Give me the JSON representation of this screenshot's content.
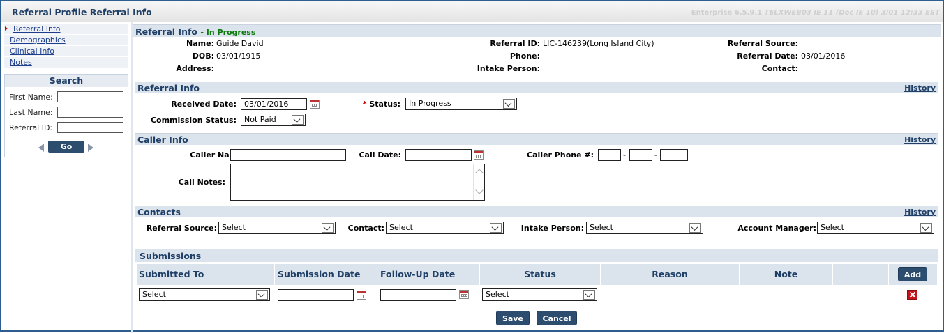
{
  "window": {
    "title": "Referral Profile Referral Info",
    "environment": "Enterprise 6.5.9.1",
    "environment_detail": "TELXWEB03 IE 11 (Doc IE 10) 3/01 12:33 EST"
  },
  "nav": {
    "items": [
      "Referral Info",
      "Demographics",
      "Clinical Info",
      "Notes"
    ]
  },
  "search": {
    "title": "Search",
    "first_name_label": "First Name:",
    "last_name_label": "Last Name:",
    "referral_id_label": "Referral ID:",
    "go_label": "Go"
  },
  "header": {
    "title": "Referral Info",
    "status": "- In Progress",
    "name_label": "Name:",
    "name_value": "Guide David",
    "dob_label": "DOB:",
    "dob_value": "03/01/1915",
    "address_label": "Address:",
    "referral_id_label": "Referral ID:",
    "referral_id_value": "LIC-146239(Long Island City)",
    "phone_label": "Phone:",
    "intake_person_label": "Intake Person:",
    "referral_source_label": "Referral Source:",
    "referral_date_label": "Referral Date:",
    "referral_date_value": "03/01/2016",
    "contact_label": "Contact:"
  },
  "referral_info": {
    "title": "Referral Info",
    "history": "History",
    "received_date_label": "Received Date:",
    "received_date_value": "03/01/2016",
    "status_required": "*",
    "status_label": "Status:",
    "status_value": "In Progress",
    "commission_label": "Commission Status:",
    "commission_value": "Not Paid"
  },
  "caller_info": {
    "title": "Caller Info",
    "history": "History",
    "caller_name_label": "Caller Name:",
    "call_date_label": "Call Date:",
    "caller_phone_label": "Caller Phone #:",
    "dash": "-",
    "call_notes_label": "Call Notes:"
  },
  "contacts": {
    "title": "Contacts",
    "history": "History",
    "referral_source_label": "Referral Source:",
    "referral_source_value": "Select",
    "contact_label": "Contact:",
    "contact_value": "Select",
    "intake_person_label": "Intake Person:",
    "intake_person_value": "Select",
    "account_manager_label": "Account Manager:",
    "account_manager_value": "Select"
  },
  "submissions": {
    "title": "Submissions",
    "columns": [
      "Submitted To",
      "Submission Date",
      "Follow-Up Date",
      "Status",
      "Reason",
      "Note"
    ],
    "add_label": "Add",
    "row": {
      "submitted_to": "Select",
      "status": "Select"
    }
  },
  "actions": {
    "save_label": "Save",
    "cancel_label": "Cancel"
  },
  "colors": {
    "header_blue": "#1f3f66",
    "button_navy": "#2d4d6e",
    "status_green": "#0a7a0a",
    "required_red": "#cc0000"
  }
}
